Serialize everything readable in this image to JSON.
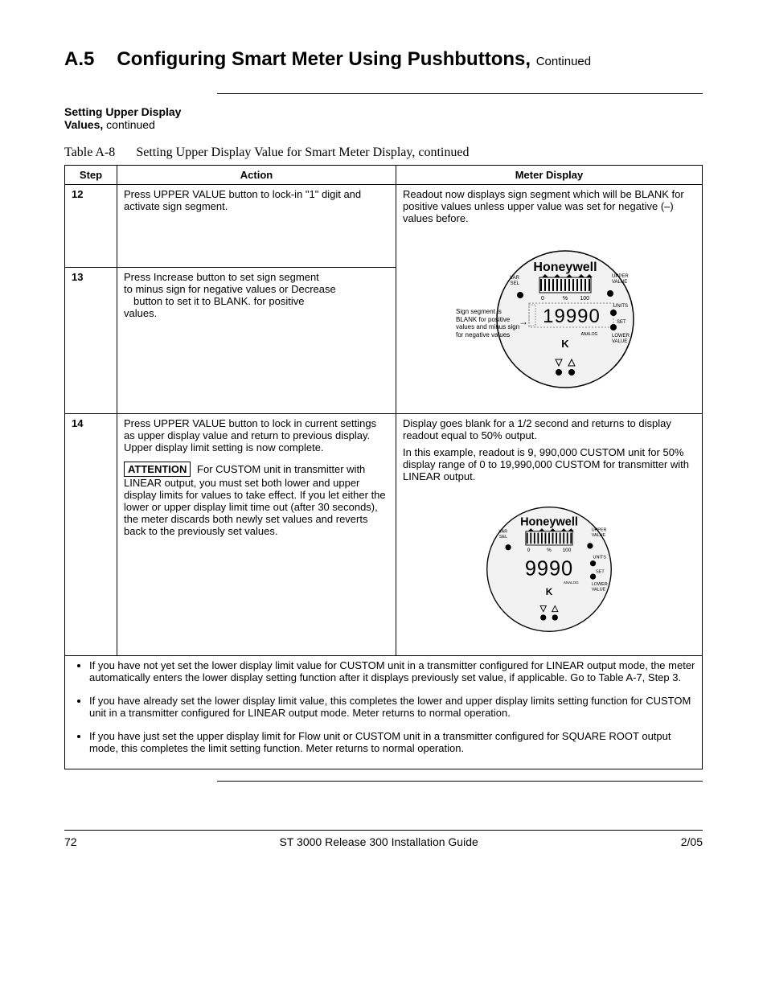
{
  "title": {
    "section": "A.5",
    "text": "Configuring Smart Meter Using Pushbuttons,",
    "continued": "Continued"
  },
  "subheading": {
    "line1": "Setting Upper Display",
    "line2_bold": "Values,",
    "line2_rest": " continued"
  },
  "tableCaption": {
    "number": "Table A-8",
    "text": "Setting Upper Display Value for Smart Meter Display, continued"
  },
  "headers": {
    "step": "Step",
    "action": "Action",
    "meter": "Meter Display"
  },
  "rows": {
    "r12": {
      "step": "12",
      "action": "Press UPPER VALUE button to lock-in \"1\" digit and activate sign segment."
    },
    "r13": {
      "step": "13",
      "action_l1": "Press Increase       button to set sign segment",
      "action_l2": "to minus sign for negative values or Decrease",
      "action_l3": "      button to set it to BLANK. for positive",
      "action_l4": "values."
    },
    "r12_13_meter": {
      "text": "Readout now displays sign segment which will be BLANK for positive values unless upper value was set for negative (–) values before.",
      "sideNote": "Sign segment is BLANK for positive values and minus sign for negative values"
    },
    "r14": {
      "step": "14",
      "action_p1": "Press UPPER VALUE button to lock in current settings as upper display value and return to previous display. Upper display limit setting is now complete.",
      "attention_label": "ATTENTION",
      "action_p2": " For CUSTOM unit in transmitter with LINEAR output, you must set both lower and upper display limits for values to take effect. If you let either the lower or upper display limit time out (after 30 seconds), the meter discards both newly set values and reverts back to the previously set values.",
      "meter_p1": "Display goes blank for a 1/2 second and returns to display readout equal to 50% output.",
      "meter_p2": "In this example, readout is 9, 990,000 CUSTOM unit for 50% display range of 0 to 19,990,000 CUSTOM for transmitter with LINEAR output."
    }
  },
  "meterA": {
    "brand": "Honeywell",
    "readout": "19990",
    "unit": "K",
    "analog": "ANALOG",
    "zero": "0",
    "pct": "%",
    "hundred": "100",
    "varsel": "VAR\nSEL",
    "uppervalue": "UPPER\nVALUE",
    "units": "UNITS",
    "set": "SET",
    "lowervalue": "LOWER\nVALUE"
  },
  "meterB": {
    "brand": "Honeywell",
    "readout": "9990",
    "unit": "K",
    "analog": "ANALOG",
    "zero": "0",
    "pct": "%",
    "hundred": "100",
    "varsel": "VAR\nSEL",
    "uppervalue": "UPPER\nVALUE",
    "units": "UNITS",
    "set": "SET",
    "lowervalue": "LOWER\nVALUE"
  },
  "notes": {
    "n1": "If you have not yet set the lower display limit value for CUSTOM unit in a transmitter configured for LINEAR output mode, the meter automatically enters the lower display setting function after it displays previously set value, if applicable. Go to Table A-7, Step 3.",
    "n2": "If you have already set the lower display limit value, this completes the lower and upper display limits setting function for CUSTOM unit in a transmitter configured for LINEAR output mode. Meter returns to normal operation.",
    "n3": "If you have just set the upper display limit for Flow unit or CUSTOM unit in a transmitter configured for SQUARE ROOT output mode, this completes the limit setting function. Meter returns to normal operation."
  },
  "footer": {
    "page": "72",
    "title": "ST 3000 Release 300 Installation Guide",
    "date": "2/05"
  }
}
